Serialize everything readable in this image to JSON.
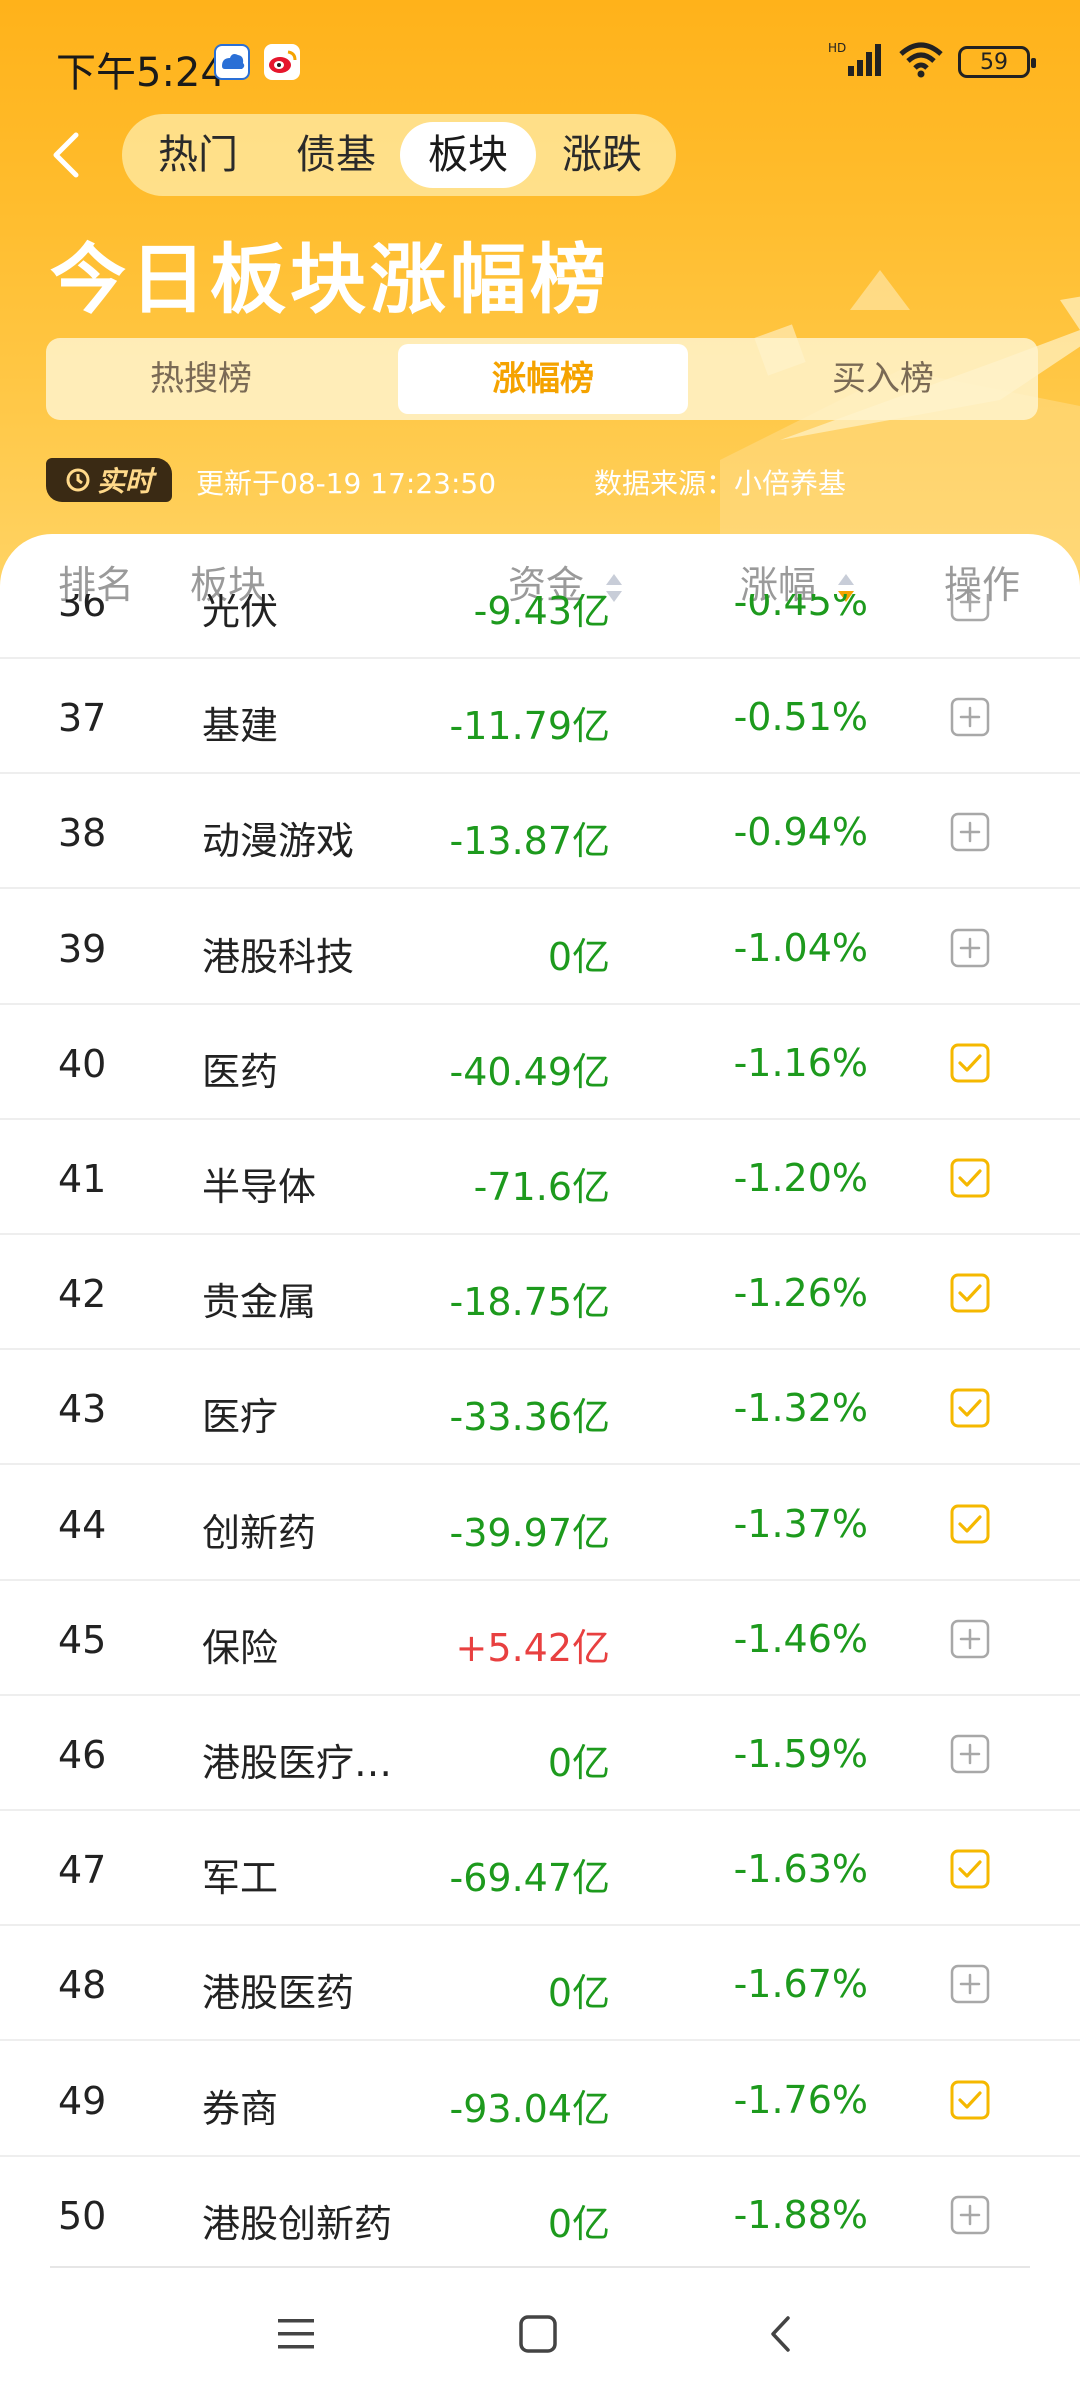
{
  "status_bar": {
    "time": "下午5:24",
    "battery": "59",
    "network": "HD"
  },
  "nav": {
    "tabs": [
      "热门",
      "债基",
      "板块",
      "涨跌"
    ],
    "active_tab": "板块"
  },
  "page_title": "今日板块涨幅榜",
  "sub_tabs": {
    "items": [
      "热搜榜",
      "涨幅榜",
      "买入榜"
    ],
    "active": "涨幅榜"
  },
  "realtime": {
    "badge": "实时",
    "updated": "更新于08-19 17:23:50",
    "source": "数据来源：小倍养基"
  },
  "columns": {
    "rank": "排名",
    "sector": "板块",
    "fund": "资金",
    "change": "涨幅",
    "action": "操作"
  },
  "colors": {
    "accent": "#f5a300",
    "negative": "#1d9a1d",
    "positive": "#e84040"
  },
  "rows": [
    {
      "rank": "36",
      "sector": "光伏",
      "fund": "-9.43亿",
      "change": "-0.45%",
      "fund_sign": "neg",
      "checked": false
    },
    {
      "rank": "37",
      "sector": "基建",
      "fund": "-11.79亿",
      "change": "-0.51%",
      "fund_sign": "neg",
      "checked": false
    },
    {
      "rank": "38",
      "sector": "动漫游戏",
      "fund": "-13.87亿",
      "change": "-0.94%",
      "fund_sign": "neg",
      "checked": false
    },
    {
      "rank": "39",
      "sector": "港股科技",
      "fund": "0亿",
      "change": "-1.04%",
      "fund_sign": "neg",
      "checked": false
    },
    {
      "rank": "40",
      "sector": "医药",
      "fund": "-40.49亿",
      "change": "-1.16%",
      "fund_sign": "neg",
      "checked": true
    },
    {
      "rank": "41",
      "sector": "半导体",
      "fund": "-71.6亿",
      "change": "-1.20%",
      "fund_sign": "neg",
      "checked": true
    },
    {
      "rank": "42",
      "sector": "贵金属",
      "fund": "-18.75亿",
      "change": "-1.26%",
      "fund_sign": "neg",
      "checked": true
    },
    {
      "rank": "43",
      "sector": "医疗",
      "fund": "-33.36亿",
      "change": "-1.32%",
      "fund_sign": "neg",
      "checked": true
    },
    {
      "rank": "44",
      "sector": "创新药",
      "fund": "-39.97亿",
      "change": "-1.37%",
      "fund_sign": "neg",
      "checked": true
    },
    {
      "rank": "45",
      "sector": "保险",
      "fund": "+5.42亿",
      "change": "-1.46%",
      "fund_sign": "pos",
      "checked": false
    },
    {
      "rank": "46",
      "sector": "港股医疗…",
      "fund": "0亿",
      "change": "-1.59%",
      "fund_sign": "neg",
      "checked": false
    },
    {
      "rank": "47",
      "sector": "军工",
      "fund": "-69.47亿",
      "change": "-1.63%",
      "fund_sign": "neg",
      "checked": true
    },
    {
      "rank": "48",
      "sector": "港股医药",
      "fund": "0亿",
      "change": "-1.67%",
      "fund_sign": "neg",
      "checked": false
    },
    {
      "rank": "49",
      "sector": "券商",
      "fund": "-93.04亿",
      "change": "-1.76%",
      "fund_sign": "neg",
      "checked": true
    },
    {
      "rank": "50",
      "sector": "港股创新药",
      "fund": "0亿",
      "change": "-1.88%",
      "fund_sign": "neg",
      "checked": false
    }
  ]
}
